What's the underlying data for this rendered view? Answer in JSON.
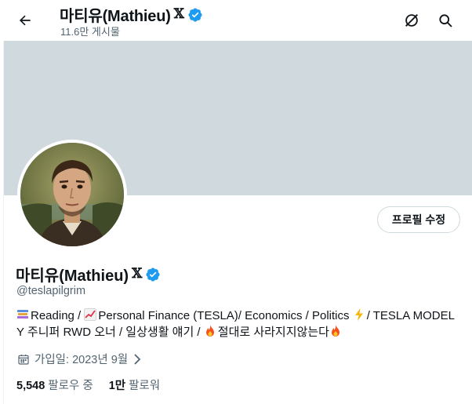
{
  "header": {
    "name": "마티유(Mathieu)",
    "x_badge": "𝕏",
    "post_count": "11.6만 게시물"
  },
  "profile": {
    "display_name": "마티유(Mathieu)",
    "x_badge": "𝕏",
    "handle": "@teslapilgrim",
    "edit_button": "프로필 수정",
    "bio": {
      "part1": "Reading / ",
      "part2": "Personal Finance (TESLA)/ Economics / Politics ",
      "part3": "/ TESLA MODEL Y 주니퍼 RWD 오너 / 일상생활 얘기 / ",
      "part4": "절대로 사라지지않는다"
    },
    "joined": "가입일: 2023년 9월",
    "following_count": "5,548",
    "following_label": "팔로우 중",
    "followers_count": "1만",
    "followers_label": "팔로워"
  },
  "colors": {
    "verified_blue": "#1d9bf0",
    "banner": "#cfd9de",
    "secondary_text": "#536471"
  }
}
